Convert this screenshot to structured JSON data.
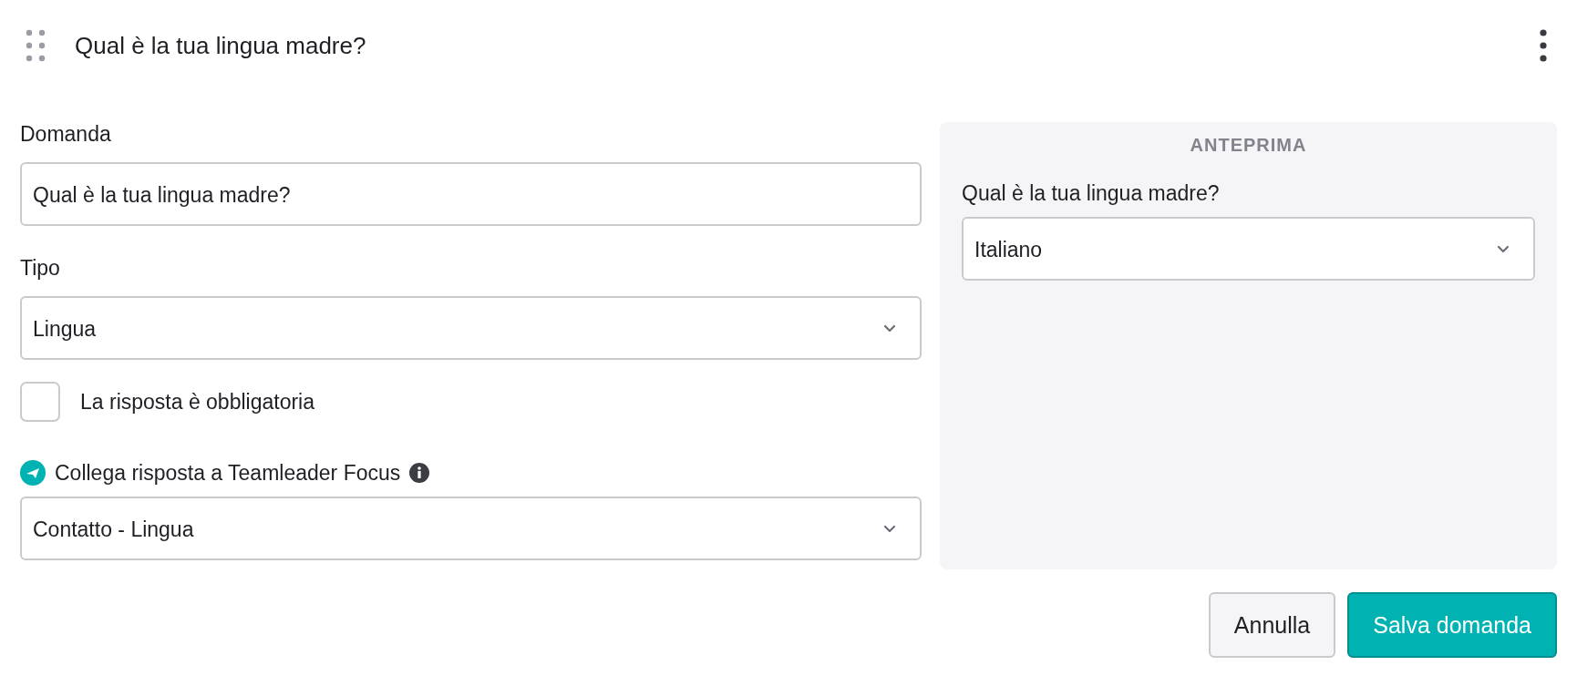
{
  "header": {
    "title": "Qual è la tua lingua madre?"
  },
  "form": {
    "question": {
      "label": "Domanda",
      "value": "Qual è la tua lingua madre?"
    },
    "type": {
      "label": "Tipo",
      "value": "Lingua"
    },
    "required": {
      "label": "La risposta è obbligatoria",
      "checked": false
    },
    "link": {
      "label": "Collega risposta a Teamleader Focus",
      "value": "Contatto - Lingua"
    }
  },
  "preview": {
    "heading": "ANTEPRIMA",
    "question": "Qual è la tua lingua madre?",
    "value": "Italiano"
  },
  "buttons": [
    {
      "label": "Annulla",
      "kind": "secondary"
    },
    {
      "label": "Salva domanda",
      "kind": "primary"
    }
  ]
}
